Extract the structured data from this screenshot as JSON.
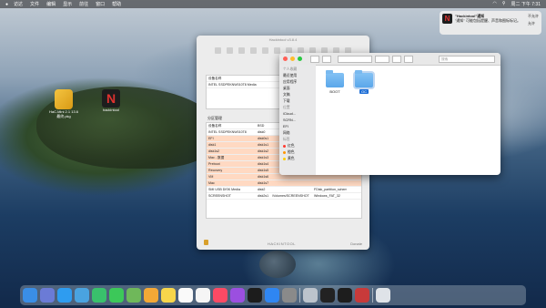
{
  "menubar": {
    "apple": "",
    "items": [
      "访达",
      "文件",
      "编辑",
      "显示",
      "前往",
      "窗口",
      "帮助"
    ],
    "clock": "周二 下午 7:31"
  },
  "desktop": [
    {
      "label": "HaC.Mini 2.1 13.6 最终.pkg"
    },
    {
      "label": "hackintool"
    }
  ],
  "notification": {
    "title": "\"Hackintool\"通知",
    "body": "\"通知\" 可能包括提醒、声音和图标标记。",
    "btn1": "不允许",
    "btn2": "允许"
  },
  "hackintool": {
    "title": "Hackintool v3.8.4",
    "top_panel": {
      "col1": "设备名称",
      "value": "INTEL SSDPEKNW010T8 Media",
      "disk": "disk0"
    },
    "section_label": "分区管理",
    "header": [
      "设备名称",
      "BSD"
    ],
    "rows": [
      {
        "name": "INTEL SSDPEKNW010T8",
        "bsd": "disk0"
      },
      {
        "name": "EFI",
        "bsd": "disk0s1"
      },
      {
        "name": "disk1",
        "bsd": "disk1s1"
      },
      {
        "name": "disk1s2",
        "bsd": "disk1s2"
      },
      {
        "name": "Mac - 数据",
        "bsd": "disk1s3"
      },
      {
        "name": "Preboot",
        "bsd": "disk1s4"
      },
      {
        "name": "Recovery",
        "bsd": "disk1s5"
      },
      {
        "name": "VM",
        "bsd": "disk1s6"
      },
      {
        "name": "Mac",
        "bsd": "disk1s7"
      },
      {
        "name": "SMI USB DISK Media",
        "bsd": "disk2"
      },
      {
        "name": "SCREENSHOT",
        "bsd": "disk2s1"
      }
    ],
    "mount_col": "/Volumes/SCREENSHOT",
    "fs_col": "Windows_FAT_32",
    "scheme_col": "FDisk_partition_scheme",
    "footer_brand": "HACKINTOOL",
    "footer_right": "Donate"
  },
  "finder": {
    "search_placeholder": "搜索",
    "sidebar": [
      {
        "text": "个人收藏",
        "header": true
      },
      {
        "text": "最近使用"
      },
      {
        "text": "应用程序"
      },
      {
        "text": "桌面"
      },
      {
        "text": "文稿"
      },
      {
        "text": "下载"
      },
      {
        "text": "位置",
        "header": true
      },
      {
        "text": "iCloud..."
      },
      {
        "text": "SCRN..."
      },
      {
        "text": "EFI"
      },
      {
        "text": "网络"
      },
      {
        "text": "标签",
        "header": true
      },
      {
        "text": "红色"
      },
      {
        "text": "橙色"
      },
      {
        "text": "黄色"
      }
    ],
    "folders": [
      {
        "label": "BOOT"
      },
      {
        "label": "OC"
      }
    ]
  },
  "dock": [
    "finder",
    "launchpad",
    "safari",
    "preview",
    "facetime",
    "messages",
    "maps",
    "photos",
    "notes",
    "calendar",
    "reminders",
    "music",
    "podcasts",
    "tv",
    "appstore",
    "prefs",
    "drive",
    "terminal",
    "hackintool",
    "hack2",
    "trash"
  ]
}
